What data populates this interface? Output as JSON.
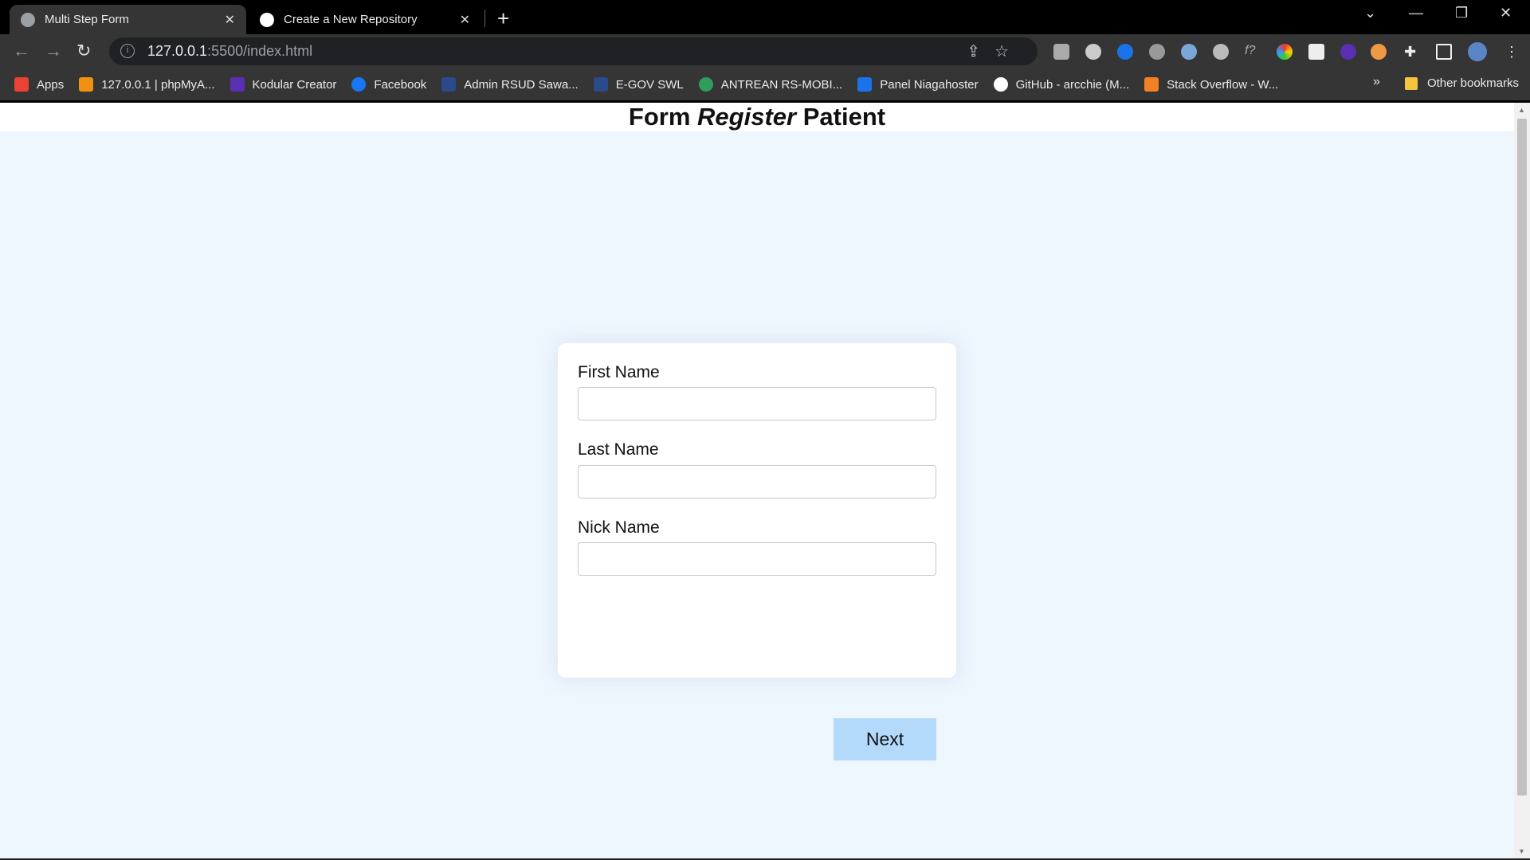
{
  "browser": {
    "tabs": [
      {
        "title": "Multi Step Form",
        "icon": "globe-icon",
        "active": true
      },
      {
        "title": "Create a New Repository",
        "icon": "github-icon",
        "active": false
      }
    ],
    "new_tab": "+",
    "url_host": "127.0.0.1",
    "url_rest": ":5500/index.html",
    "bookmarks": [
      {
        "label": "Apps",
        "icon": "apps-grid-icon",
        "color": "#ea4335"
      },
      {
        "label": "127.0.0.1 | phpMyA...",
        "icon": "phpmyadmin-icon",
        "color": "#f29111"
      },
      {
        "label": "Kodular Creator",
        "icon": "kodular-icon",
        "color": "#5b2fb3"
      },
      {
        "label": "Facebook",
        "icon": "facebook-icon",
        "color": "#1877f2"
      },
      {
        "label": "Admin RSUD Sawa...",
        "icon": "shield-icon",
        "color": "#2a4a8a"
      },
      {
        "label": "E-GOV SWL",
        "icon": "shield-icon",
        "color": "#2a4a8a"
      },
      {
        "label": "ANTREAN RS-MOBI...",
        "icon": "hospital-icon",
        "color": "#2e9e5b"
      },
      {
        "label": "Panel Niagahoster",
        "icon": "niagahoster-icon",
        "color": "#1a73e8"
      },
      {
        "label": "GitHub - arcchie (M...",
        "icon": "github-icon",
        "color": "#ffffff"
      },
      {
        "label": "Stack Overflow - W...",
        "icon": "stackoverflow-icon",
        "color": "#f48024"
      }
    ],
    "more_bookmarks": "»",
    "other_bookmarks": "Other bookmarks"
  },
  "page": {
    "title_pre": "Form",
    "title_em": "Register",
    "title_post": "Patient",
    "fields": [
      {
        "label": "First Name",
        "value": ""
      },
      {
        "label": "Last Name",
        "value": ""
      },
      {
        "label": "Nick Name",
        "value": ""
      }
    ],
    "next_label": "Next",
    "colors": {
      "background": "#eef6fe",
      "button": "#b3d9fb"
    }
  }
}
